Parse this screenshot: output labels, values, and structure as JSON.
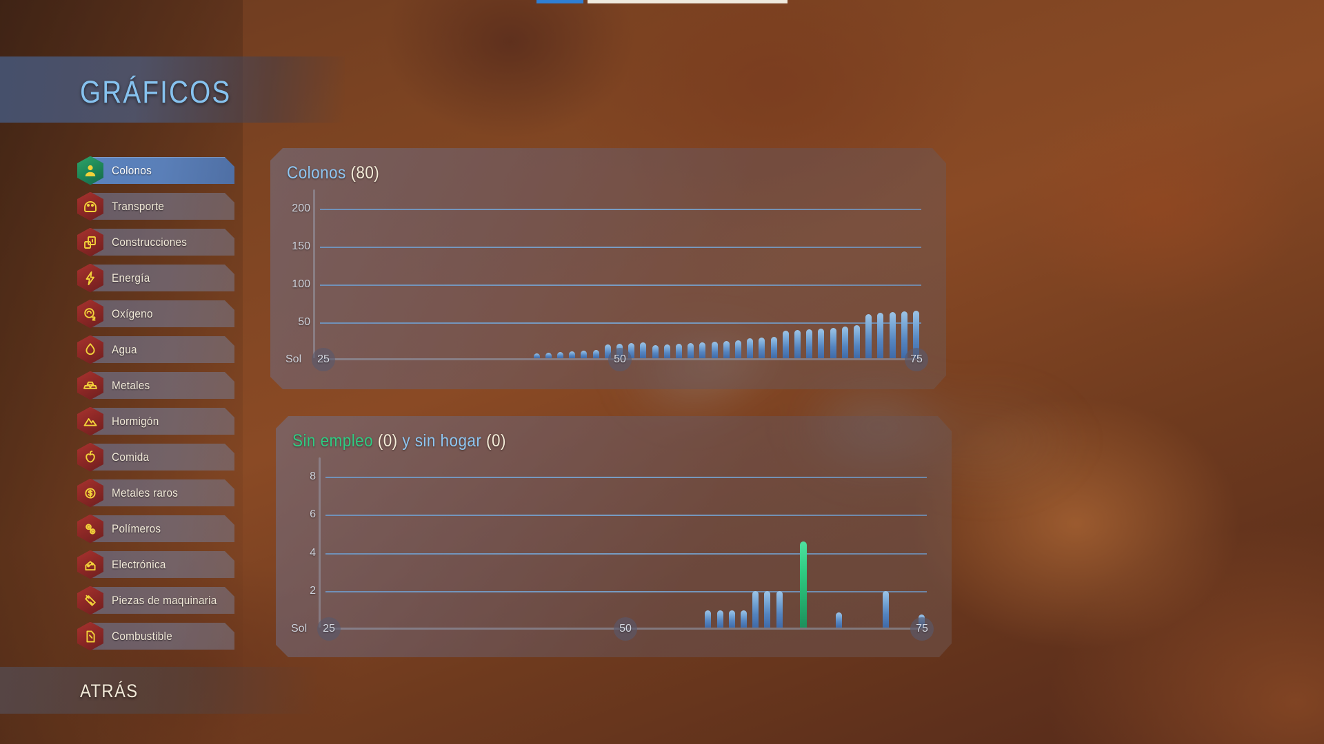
{
  "header": {
    "title": "GRÁFICOS"
  },
  "topbar": {
    "accent_color": "#2f7fd4",
    "fill_color": "#efeade"
  },
  "sidebar": {
    "items": [
      {
        "label": "Colonos",
        "icon": "colonist-icon",
        "selected": true
      },
      {
        "label": "Transporte",
        "icon": "transport-icon",
        "selected": false
      },
      {
        "label": "Construcciones",
        "icon": "buildings-icon",
        "selected": false
      },
      {
        "label": "Energía",
        "icon": "power-bolt-icon",
        "selected": false
      },
      {
        "label": "Oxígeno",
        "icon": "oxygen-icon",
        "selected": false
      },
      {
        "label": "Agua",
        "icon": "water-drop-icon",
        "selected": false
      },
      {
        "label": "Metales",
        "icon": "metal-bars-icon",
        "selected": false
      },
      {
        "label": "Hormigón",
        "icon": "concrete-icon",
        "selected": false
      },
      {
        "label": "Comida",
        "icon": "food-apple-icon",
        "selected": false
      },
      {
        "label": "Metales raros",
        "icon": "rare-metals-icon",
        "selected": false
      },
      {
        "label": "Polímeros",
        "icon": "polymers-icon",
        "selected": false
      },
      {
        "label": "Electrónica",
        "icon": "electronics-icon",
        "selected": false
      },
      {
        "label": "Piezas de maquinaria",
        "icon": "machine-parts-icon",
        "selected": false
      },
      {
        "label": "Combustible",
        "icon": "fuel-icon",
        "selected": false
      }
    ]
  },
  "back_button": {
    "label": "ATRÁS"
  },
  "colors": {
    "title_blue": "#86c2ef",
    "text_cream": "#f2ead9",
    "green": "#2fcb82",
    "bar_blue": "#5585c0",
    "gridline": "#6ea0d4"
  },
  "chart_data": [
    {
      "type": "bar",
      "panel_id": "colonists-chart",
      "title_parts": [
        {
          "text": "Colonos",
          "color": "#8ec6f2"
        },
        {
          "text": "(80)",
          "color": "#f4ecd8"
        }
      ],
      "title": "Colonos (80)",
      "value_label": "(80)",
      "xlabel": "Sol",
      "ylabel": "",
      "ylim": [
        0,
        225
      ],
      "yticks": [
        200,
        150,
        100,
        50
      ],
      "grid": true,
      "xticks": [
        25,
        50,
        75
      ],
      "x_axis_prefix": "Sol",
      "x": [
        25,
        26,
        27,
        28,
        29,
        30,
        31,
        32,
        33,
        34,
        35,
        36,
        37,
        38,
        39,
        40,
        41,
        42,
        43,
        44,
        45,
        46,
        47,
        48,
        49,
        50,
        51,
        52,
        53,
        54,
        55,
        56,
        57,
        58,
        59,
        60,
        61,
        62,
        63,
        64,
        65,
        66,
        67,
        68,
        69,
        70,
        71,
        72,
        73,
        74,
        75
      ],
      "values": [
        0,
        0,
        0,
        0,
        0,
        0,
        0,
        0,
        0,
        0,
        0,
        0,
        0,
        0,
        0,
        0,
        0,
        0,
        6,
        7,
        8,
        9,
        10,
        11,
        18,
        19,
        20,
        21,
        17,
        18,
        19,
        20,
        21,
        22,
        23,
        24,
        26,
        27,
        28,
        36,
        37,
        38,
        39,
        40,
        42,
        44,
        58,
        60,
        61,
        62,
        63,
        64
      ]
    },
    {
      "type": "bar",
      "panel_id": "unemployed-homeless-chart",
      "title_parts": [
        {
          "text": "Sin empleo",
          "color": "#2fcb82"
        },
        {
          "text": "(0)",
          "color": "#f4ecd8"
        },
        {
          "text": "y sin hogar",
          "color": "#8ec6f2"
        },
        {
          "text": "(0)",
          "color": "#f4ecd8"
        }
      ],
      "title": "Sin empleo (0) y sin hogar (0)",
      "unemployed_value": "(0)",
      "homeless_value": "(0)",
      "xlabel": "Sol",
      "ylabel": "",
      "ylim": [
        0,
        9
      ],
      "yticks": [
        8,
        6,
        4,
        2
      ],
      "grid": true,
      "xticks": [
        25,
        50,
        75
      ],
      "x_axis_prefix": "Sol",
      "series": [
        {
          "name": "Sin hogar",
          "color": "#5585c0",
          "x": [
            57,
            58,
            59,
            60,
            61,
            62,
            63,
            68,
            72,
            75
          ],
          "values": [
            0.9,
            0.9,
            0.9,
            0.9,
            1.9,
            1.9,
            1.9,
            0.8,
            1.9,
            0.7
          ]
        },
        {
          "name": "Sin empleo",
          "color": "#2fcb82",
          "x": [
            65
          ],
          "values": [
            4.5
          ]
        }
      ]
    }
  ]
}
